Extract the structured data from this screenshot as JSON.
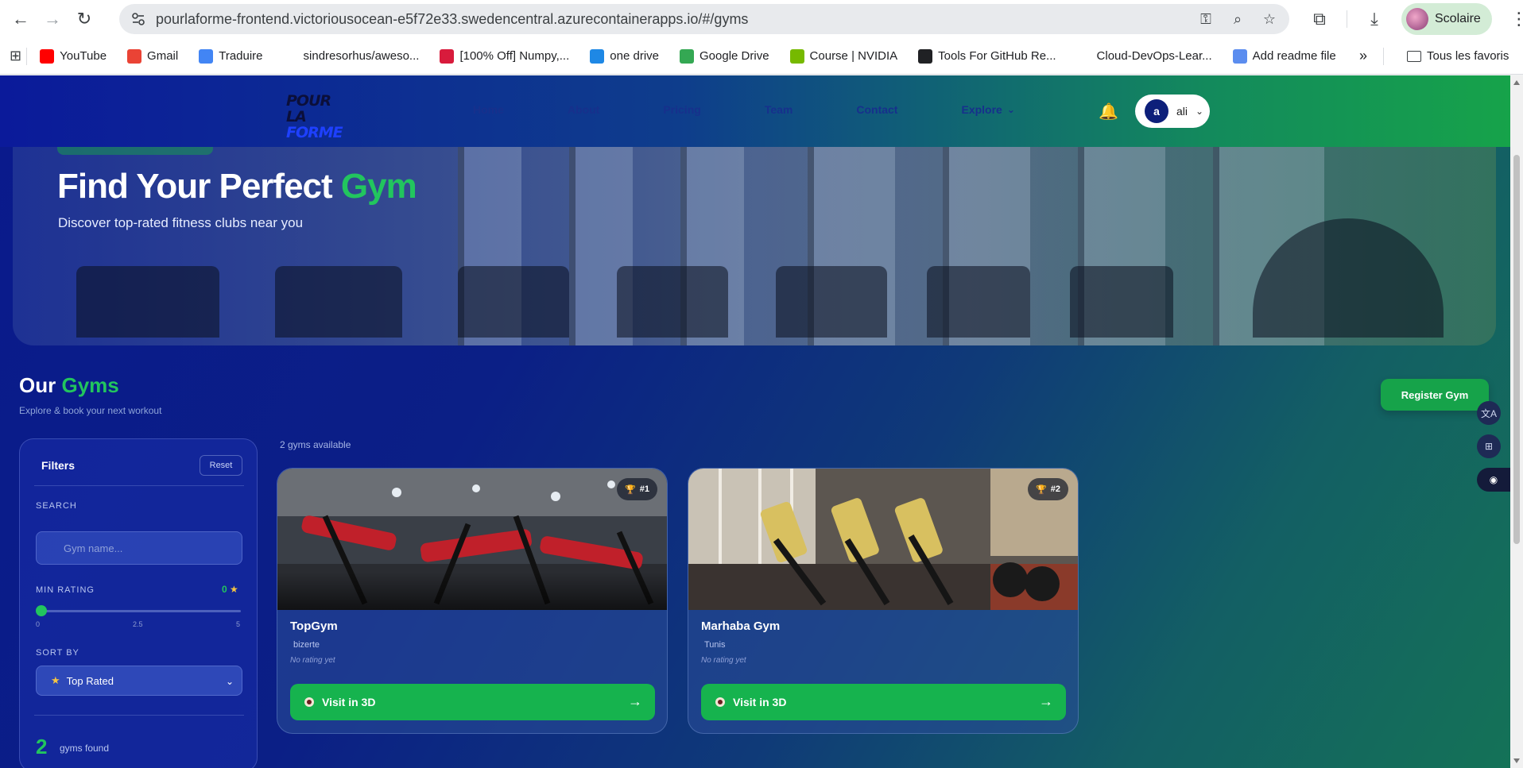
{
  "browser": {
    "url": "pourlaforme-frontend.victoriousocean-e5f72e33.swedencentral.azurecontainerapps.io/#/gyms",
    "profile_name": "Scolaire",
    "bookmarks": [
      {
        "label": "YouTube",
        "color": "#ff0000"
      },
      {
        "label": "Gmail",
        "color": "#ea4335"
      },
      {
        "label": "Traduire",
        "color": "#4285f4"
      },
      {
        "label": "sindresorhus/aweso...",
        "color": "#ffffff"
      },
      {
        "label": "[100% Off] Numpy,...",
        "color": "#d81b3c"
      },
      {
        "label": "one drive",
        "color": "#1e88e5"
      },
      {
        "label": "Google Drive",
        "color": "#34a853"
      },
      {
        "label": "Course | NVIDIA",
        "color": "#76b900"
      },
      {
        "label": "Tools For GitHub Re...",
        "color": "#202124"
      },
      {
        "label": "Cloud-DevOps-Lear...",
        "color": "#ffffff"
      },
      {
        "label": "Add readme file",
        "color": "#5b8def"
      }
    ],
    "overflow_label": "»",
    "all_bookmarks_label": "Tous les favoris"
  },
  "header": {
    "logo_line1": "POUR LA",
    "logo_line2": "FORME",
    "nav": [
      "Home",
      "About",
      "Pricing",
      "Team",
      "Contact",
      "Explore"
    ],
    "user_initial": "a",
    "user_name": "ali"
  },
  "hero": {
    "title_main": "Find Your Perfect",
    "title_accent": "Gym",
    "subtitle": "Discover top-rated fitness clubs near you"
  },
  "section": {
    "title_main": "Our",
    "title_accent": "Gyms",
    "subtitle": "Explore & book your next workout",
    "register_label": "Register Gym",
    "available_text": "2 gyms available"
  },
  "filters": {
    "title": "Filters",
    "reset_label": "Reset",
    "search_label": "SEARCH",
    "search_placeholder": "Gym name...",
    "rating_label": "MIN RATING",
    "rating_value": "0",
    "rating_min": "0",
    "rating_mid": "2.5",
    "rating_max": "5",
    "rating_level": 0,
    "sort_label": "SORT BY",
    "sort_value": "Top Rated",
    "found_count": "2",
    "found_label": "gyms found"
  },
  "gyms": [
    {
      "rank": "#1",
      "name": "TopGym",
      "city": "bizerte",
      "rating_text": "No rating yet",
      "cta": "Visit in 3D"
    },
    {
      "rank": "#2",
      "name": "Marhaba Gym",
      "city": "Tunis",
      "rating_text": "No rating yet",
      "cta": "Visit in 3D"
    }
  ]
}
